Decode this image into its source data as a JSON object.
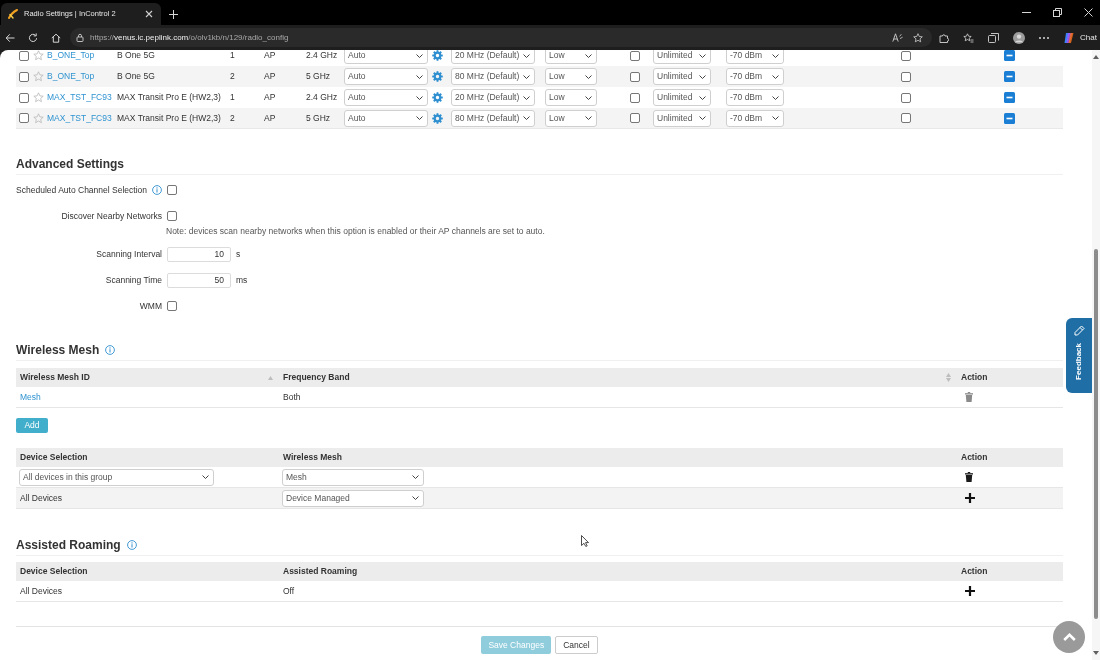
{
  "browser": {
    "tabs": [
      {
        "title": "Radio Settings | InControl 2",
        "selected": true
      }
    ],
    "url": {
      "scheme": "https://",
      "host": "venus.ic.peplink.com",
      "path": "/o/olv1kb/n/129/radio_config"
    },
    "chat_label": "Chat"
  },
  "radio_table": {
    "rows": [
      {
        "checked": false,
        "starred": false,
        "cells": [
          {
            "kind": "link",
            "text": "B_ONE_Top"
          },
          {
            "kind": "text",
            "text": "B One 5G"
          },
          {
            "kind": "text",
            "text": "1"
          },
          {
            "kind": "text",
            "text": "AP"
          },
          {
            "kind": "text",
            "text": "2.4 GHz"
          },
          {
            "kind": "select",
            "text": "Auto"
          },
          {
            "kind": "gear"
          },
          {
            "kind": "select",
            "text": "20 MHz (Default)"
          },
          {
            "kind": "select",
            "text": "Low"
          },
          {
            "kind": "checkbox",
            "checked": false
          },
          {
            "kind": "select",
            "text": "Unlimited"
          },
          {
            "kind": "select",
            "text": "-70 dBm"
          },
          {
            "kind": "checkbox",
            "checked": false
          },
          {
            "kind": "minus_button"
          }
        ]
      },
      {
        "checked": false,
        "starred": false,
        "cells": [
          {
            "kind": "link",
            "text": "B_ONE_Top"
          },
          {
            "kind": "text",
            "text": "B One 5G"
          },
          {
            "kind": "text",
            "text": "2"
          },
          {
            "kind": "text",
            "text": "AP"
          },
          {
            "kind": "text",
            "text": "5 GHz"
          },
          {
            "kind": "select",
            "text": "Auto"
          },
          {
            "kind": "gear"
          },
          {
            "kind": "select",
            "text": "80 MHz (Default)"
          },
          {
            "kind": "select",
            "text": "Low"
          },
          {
            "kind": "checkbox",
            "checked": false
          },
          {
            "kind": "select",
            "text": "Unlimited"
          },
          {
            "kind": "select",
            "text": "-70 dBm"
          },
          {
            "kind": "checkbox",
            "checked": false
          },
          {
            "kind": "minus_button"
          }
        ]
      },
      {
        "checked": false,
        "starred": false,
        "cells": [
          {
            "kind": "link",
            "text": "MAX_TST_FC93"
          },
          {
            "kind": "text",
            "text": "MAX Transit Pro E (HW2,3)"
          },
          {
            "kind": "text",
            "text": "1"
          },
          {
            "kind": "text",
            "text": "AP"
          },
          {
            "kind": "text",
            "text": "2.4 GHz"
          },
          {
            "kind": "select",
            "text": "Auto"
          },
          {
            "kind": "gear"
          },
          {
            "kind": "select",
            "text": "20 MHz (Default)"
          },
          {
            "kind": "select",
            "text": "Low"
          },
          {
            "kind": "checkbox",
            "checked": false
          },
          {
            "kind": "select",
            "text": "Unlimited"
          },
          {
            "kind": "select",
            "text": "-70 dBm"
          },
          {
            "kind": "checkbox",
            "checked": false
          },
          {
            "kind": "minus_button"
          }
        ]
      },
      {
        "checked": false,
        "starred": false,
        "cells": [
          {
            "kind": "link",
            "text": "MAX_TST_FC93"
          },
          {
            "kind": "text",
            "text": "MAX Transit Pro E (HW2,3)"
          },
          {
            "kind": "text",
            "text": "2"
          },
          {
            "kind": "text",
            "text": "AP"
          },
          {
            "kind": "text",
            "text": "5 GHz"
          },
          {
            "kind": "select",
            "text": "Auto"
          },
          {
            "kind": "gear"
          },
          {
            "kind": "select",
            "text": "80 MHz (Default)"
          },
          {
            "kind": "select",
            "text": "Low"
          },
          {
            "kind": "checkbox",
            "checked": false
          },
          {
            "kind": "select",
            "text": "Unlimited"
          },
          {
            "kind": "select",
            "text": "-70 dBm"
          },
          {
            "kind": "checkbox",
            "checked": false
          },
          {
            "kind": "minus_button"
          }
        ]
      }
    ]
  },
  "advanced_settings": {
    "title": "Advanced Settings",
    "fields": [
      {
        "kind": "checkbox",
        "label": "Scheduled Auto Channel Selection",
        "info": true,
        "checked": false
      },
      {
        "kind": "checkbox",
        "label": "Discover Nearby Networks",
        "checked": false,
        "note": "Note: devices scan nearby networks when this option is enabled or their AP channels are set to auto."
      },
      {
        "kind": "number",
        "label": "Scanning Interval",
        "value": "10",
        "unit": "s"
      },
      {
        "kind": "number",
        "label": "Scanning Time",
        "value": "50",
        "unit": "ms"
      },
      {
        "kind": "checkbox",
        "label": "WMM",
        "checked": false
      }
    ]
  },
  "wireless_mesh": {
    "title": "Wireless Mesh",
    "info": true,
    "mesh_table": {
      "columns": [
        {
          "label": "Wireless Mesh ID",
          "sortable": true,
          "sorted": true
        },
        {
          "label": "Frequency Band",
          "sortable": true,
          "sorted": false
        },
        {
          "label": "Action"
        }
      ],
      "rows": [
        {
          "cells": [
            {
              "kind": "link",
              "text": "Mesh"
            },
            {
              "kind": "text",
              "text": "Both"
            }
          ],
          "action": {
            "kind": "delete",
            "disabled": true
          }
        }
      ]
    },
    "add_button": "Add",
    "assignment_table": {
      "columns": [
        {
          "label": "Device Selection"
        },
        {
          "label": "Wireless Mesh"
        },
        {
          "label": "Action"
        }
      ],
      "rows": [
        {
          "cells": [
            {
              "kind": "select",
              "text": "All devices in this group"
            },
            {
              "kind": "select",
              "text": "Mesh"
            }
          ],
          "action": {
            "kind": "delete",
            "disabled": false
          }
        },
        {
          "cells": [
            {
              "kind": "text",
              "text": "All Devices"
            },
            {
              "kind": "select",
              "text": "Device Managed"
            }
          ],
          "action": {
            "kind": "add",
            "disabled": false
          }
        }
      ]
    }
  },
  "assisted_roaming": {
    "title": "Assisted Roaming",
    "info": true,
    "table": {
      "columns": [
        {
          "label": "Device Selection"
        },
        {
          "label": "Assisted Roaming"
        },
        {
          "label": "Action"
        }
      ],
      "rows": [
        {
          "cells": [
            {
              "kind": "text",
              "text": "All Devices"
            },
            {
              "kind": "text",
              "text": "Off"
            }
          ],
          "action": {
            "kind": "add",
            "disabled": false
          }
        }
      ]
    }
  },
  "footer_buttons": [
    {
      "label": "Save Changes",
      "kind": "primary",
      "disabled": true
    },
    {
      "label": "Cancel",
      "kind": "secondary",
      "disabled": false
    }
  ],
  "feedback_tab": {
    "label": "Feedback"
  }
}
